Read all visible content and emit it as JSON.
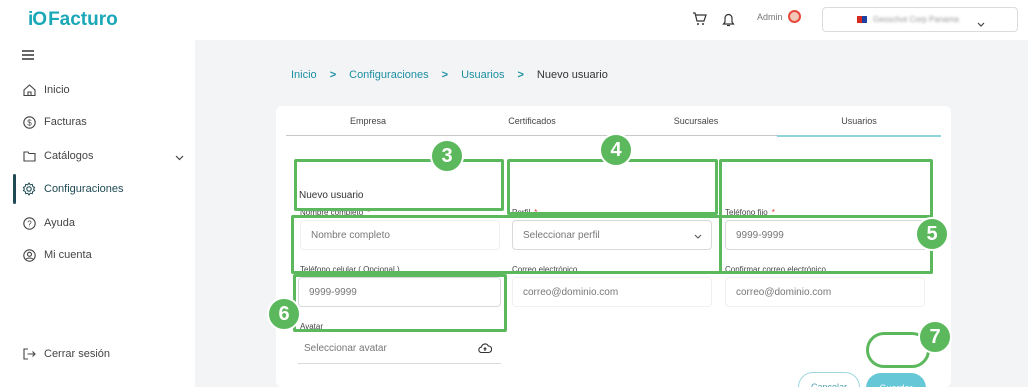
{
  "header": {
    "logo_mark": "iO",
    "logo_text": "Facturo",
    "cart_icon": "cart-icon",
    "bell_icon": "bell-icon",
    "admin_label": "Admin",
    "company_name": "Geoschot Corp Panama"
  },
  "sidebar": {
    "items": [
      {
        "label": "Inicio",
        "icon": "home-icon"
      },
      {
        "label": "Facturas",
        "icon": "dollar-icon"
      },
      {
        "label": "Catálogos",
        "icon": "folder-icon"
      },
      {
        "label": "Configuraciones",
        "icon": "gear-icon"
      },
      {
        "label": "Ayuda",
        "icon": "help-icon"
      },
      {
        "label": "Mi cuenta",
        "icon": "user-circle-icon"
      }
    ],
    "logout_label": "Cerrar sesión"
  },
  "breadcrumb": {
    "items": [
      "Inicio",
      "Configuraciones",
      "Usuarios"
    ],
    "current": "Nuevo usuario",
    "separator": ">"
  },
  "tabs": [
    "Empresa",
    "Certificados",
    "Sucursales",
    "Usuarios"
  ],
  "active_tab": "Usuarios",
  "form": {
    "title": "Nuevo usuario",
    "nombre": {
      "label": "Nombre completo",
      "placeholder": "Nombre completo",
      "required": "*"
    },
    "perfil": {
      "label": "Perfil",
      "placeholder": "Seleccionar perfil",
      "required": "*"
    },
    "telefono_fijo": {
      "label": "Teléfono fijo",
      "placeholder": "9999-9999",
      "required": "*"
    },
    "telefono_celular": {
      "label": "Teléfono celular",
      "optional": "( Opcional )",
      "placeholder": "9999-9999"
    },
    "correo": {
      "label": "Correo electrónico",
      "placeholder": "correo@dominio.com"
    },
    "confirmar_correo": {
      "label": "Confirmar correo electrónico",
      "placeholder": "correo@dominio.com"
    },
    "avatar": {
      "label": "Avatar",
      "placeholder": "Seleccionar avatar"
    },
    "cancel_label": "Cancelar",
    "save_label": "Guardar"
  },
  "annotations": [
    "3",
    "4",
    "5",
    "6",
    "7"
  ],
  "colors": {
    "accent": "#1aa7b8",
    "highlight": "#5cb85c",
    "save": "#66c7d6"
  }
}
